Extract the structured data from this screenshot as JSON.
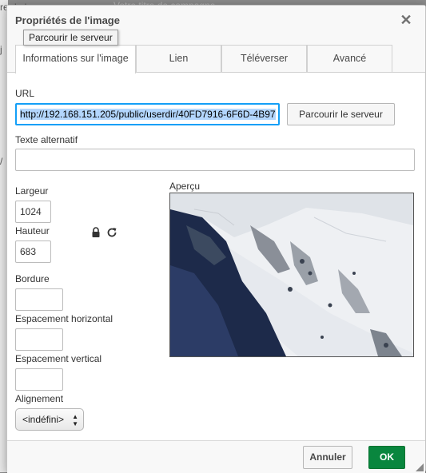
{
  "background": {
    "side_text_1": "re de la",
    "side_text_2": "j",
    "side_text_3": "/",
    "placeholder": "Votre titre de campagne"
  },
  "dialog": {
    "title": "Propriétés de l'image",
    "close_icon": "close-icon",
    "tooltip": "Parcourir le serveur"
  },
  "tabs": [
    {
      "label": "Informations sur l'image",
      "active": true
    },
    {
      "label": "Lien",
      "active": false
    },
    {
      "label": "Téléverser",
      "active": false
    },
    {
      "label": "Avancé",
      "active": false
    }
  ],
  "form": {
    "url_label": "URL",
    "url_value": "http://192.168.151.205/public/userdir/40FD7916-6F6D-4B97",
    "browse_button": "Parcourir le serveur",
    "alt_label": "Texte alternatif",
    "alt_value": "",
    "width_label": "Largeur",
    "width_value": "1024",
    "height_label": "Hauteur",
    "height_value": "683",
    "lock_icon": "lock-icon",
    "reset_icon": "reset-icon",
    "border_label": "Bordure",
    "border_value": "",
    "hspace_label": "Espacement horizontal",
    "hspace_value": "",
    "vspace_label": "Espacement vertical",
    "vspace_value": "",
    "align_label": "Alignement",
    "align_value": "<indéfini>",
    "preview_label": "Aperçu"
  },
  "footer": {
    "cancel": "Annuler",
    "ok": "OK"
  },
  "colors": {
    "ok_button": "#09863e",
    "focus_border": "#139ff7",
    "selection": "#b3d6fd"
  }
}
